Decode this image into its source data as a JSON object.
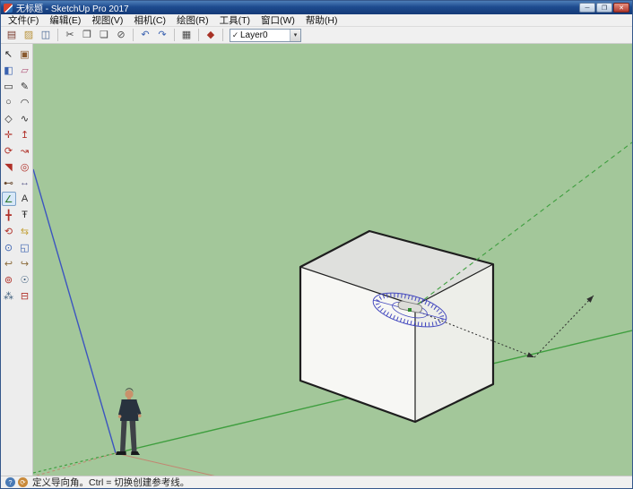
{
  "window": {
    "title": "无标题 - SketchUp Pro 2017"
  },
  "titlebar": {
    "minimize_glyph": "─",
    "maximize_glyph": "❐",
    "close_glyph": "✕"
  },
  "menu": {
    "items": [
      {
        "name": "file",
        "label": "文件(F)"
      },
      {
        "name": "edit",
        "label": "编辑(E)"
      },
      {
        "name": "view",
        "label": "视图(V)"
      },
      {
        "name": "camera",
        "label": "相机(C)"
      },
      {
        "name": "draw",
        "label": "绘图(R)"
      },
      {
        "name": "tools",
        "label": "工具(T)"
      },
      {
        "name": "window",
        "label": "窗口(W)"
      },
      {
        "name": "help",
        "label": "帮助(H)"
      }
    ]
  },
  "toolbar": {
    "layer": {
      "check": "✓",
      "value": "Layer0",
      "arrow": "▾"
    },
    "buttons": [
      {
        "name": "new",
        "glyph": "▤",
        "color": "#7a3b2e"
      },
      {
        "name": "open",
        "glyph": "▨",
        "color": "#b8923a"
      },
      {
        "name": "save",
        "glyph": "◫",
        "color": "#3f5f8f"
      },
      {
        "sep": true
      },
      {
        "name": "cut",
        "glyph": "✂",
        "color": "#4a4a4a"
      },
      {
        "name": "copy",
        "glyph": "❐",
        "color": "#4a4a4a"
      },
      {
        "name": "paste",
        "glyph": "❏",
        "color": "#4a4a4a"
      },
      {
        "name": "erase",
        "glyph": "⊘",
        "color": "#4a4a4a"
      },
      {
        "sep": true
      },
      {
        "name": "undo",
        "glyph": "↶",
        "color": "#3a62b0"
      },
      {
        "name": "redo",
        "glyph": "↷",
        "color": "#3a62b0"
      },
      {
        "sep": true
      },
      {
        "name": "print",
        "glyph": "▦",
        "color": "#4a4a4a"
      },
      {
        "sep": true
      },
      {
        "name": "model-info",
        "glyph": "◆",
        "color": "#a83226"
      },
      {
        "sep": true
      }
    ]
  },
  "palette": {
    "tools": [
      {
        "name": "select",
        "glyph": "↖",
        "color": "#1d1d1d"
      },
      {
        "name": "make-component",
        "glyph": "▣",
        "color": "#8a5a2f"
      },
      {
        "name": "paint-bucket",
        "glyph": "◧",
        "color": "#3a62b0"
      },
      {
        "name": "eraser",
        "glyph": "▱",
        "color": "#b0567a"
      },
      {
        "name": "rectangle",
        "glyph": "▭",
        "color": "#2f2f2f"
      },
      {
        "name": "line",
        "glyph": "✎",
        "color": "#2f2f2f"
      },
      {
        "name": "circle",
        "glyph": "○",
        "color": "#2f2f2f"
      },
      {
        "name": "arc",
        "glyph": "◠",
        "color": "#2f2f2f"
      },
      {
        "name": "polygon",
        "glyph": "◇",
        "color": "#2f2f2f"
      },
      {
        "name": "freehand",
        "glyph": "∿",
        "color": "#2f2f2f"
      },
      {
        "name": "move",
        "glyph": "✛",
        "color": "#b03028"
      },
      {
        "name": "push-pull",
        "glyph": "↥",
        "color": "#b03028"
      },
      {
        "name": "rotate",
        "glyph": "⟳",
        "color": "#b03028"
      },
      {
        "name": "follow-me",
        "glyph": "↝",
        "color": "#b03028"
      },
      {
        "name": "scale",
        "glyph": "◥",
        "color": "#b03028"
      },
      {
        "name": "offset",
        "glyph": "◎",
        "color": "#b03028"
      },
      {
        "name": "tape-measure",
        "glyph": "⊷",
        "color": "#6a4a2f"
      },
      {
        "name": "dimension",
        "glyph": "↔",
        "color": "#5a5a8a"
      },
      {
        "name": "protractor",
        "glyph": "∠",
        "color": "#2e7a2e",
        "active": true
      },
      {
        "name": "text",
        "glyph": "A",
        "color": "#2f2f2f"
      },
      {
        "name": "axes",
        "glyph": "╋",
        "color": "#b03028"
      },
      {
        "name": "3d-text",
        "glyph": "Ŧ",
        "color": "#2f2f2f"
      },
      {
        "name": "orbit",
        "glyph": "⟲",
        "color": "#b03028"
      },
      {
        "name": "pan",
        "glyph": "⇆",
        "color": "#c4a23c"
      },
      {
        "name": "zoom",
        "glyph": "⊙",
        "color": "#3a62b0"
      },
      {
        "name": "zoom-extents",
        "glyph": "◱",
        "color": "#3a62b0"
      },
      {
        "name": "previous",
        "glyph": "↩",
        "color": "#8a6a3a"
      },
      {
        "name": "next",
        "glyph": "↪",
        "color": "#8a6a3a"
      },
      {
        "name": "position-camera",
        "glyph": "⊚",
        "color": "#b03028"
      },
      {
        "name": "look-around",
        "glyph": "☉",
        "color": "#3a5a7a"
      },
      {
        "name": "walk",
        "glyph": "⁂",
        "color": "#3a5a7a"
      },
      {
        "name": "section-plane",
        "glyph": "⊟",
        "color": "#b03028"
      }
    ]
  },
  "canvas": {
    "background": "#A3C79A",
    "axes": {
      "green": "#3E9E3E",
      "blue": "#3C55C0",
      "red": "#C87B6B"
    },
    "guide": {
      "dotted_color": "#2E2E2E"
    },
    "cube": {
      "top": "#DFE0DD",
      "left": "#F7F7F4",
      "right": "#EDEEE9",
      "edge": "#1E1E1E"
    },
    "protractor": {
      "color": "#4348BE",
      "center": "#2E8B2E",
      "cursor_fill": "#DCDCD8",
      "cursor_stroke": "#808080"
    },
    "person": {
      "skin": "#C9916B",
      "hair": "#26262A",
      "shirt": "#28323E",
      "pants": "#3E4147",
      "shoes": "#17191C"
    }
  },
  "statusbar": {
    "message": "定义导向角。Ctrl = 切换创建参考线。",
    "icons": [
      {
        "name": "geolocation-icon",
        "glyph": "?",
        "color": "#4A7AB5"
      },
      {
        "name": "credits-icon",
        "glyph": "⟳",
        "color": "#C98A3A"
      }
    ]
  }
}
